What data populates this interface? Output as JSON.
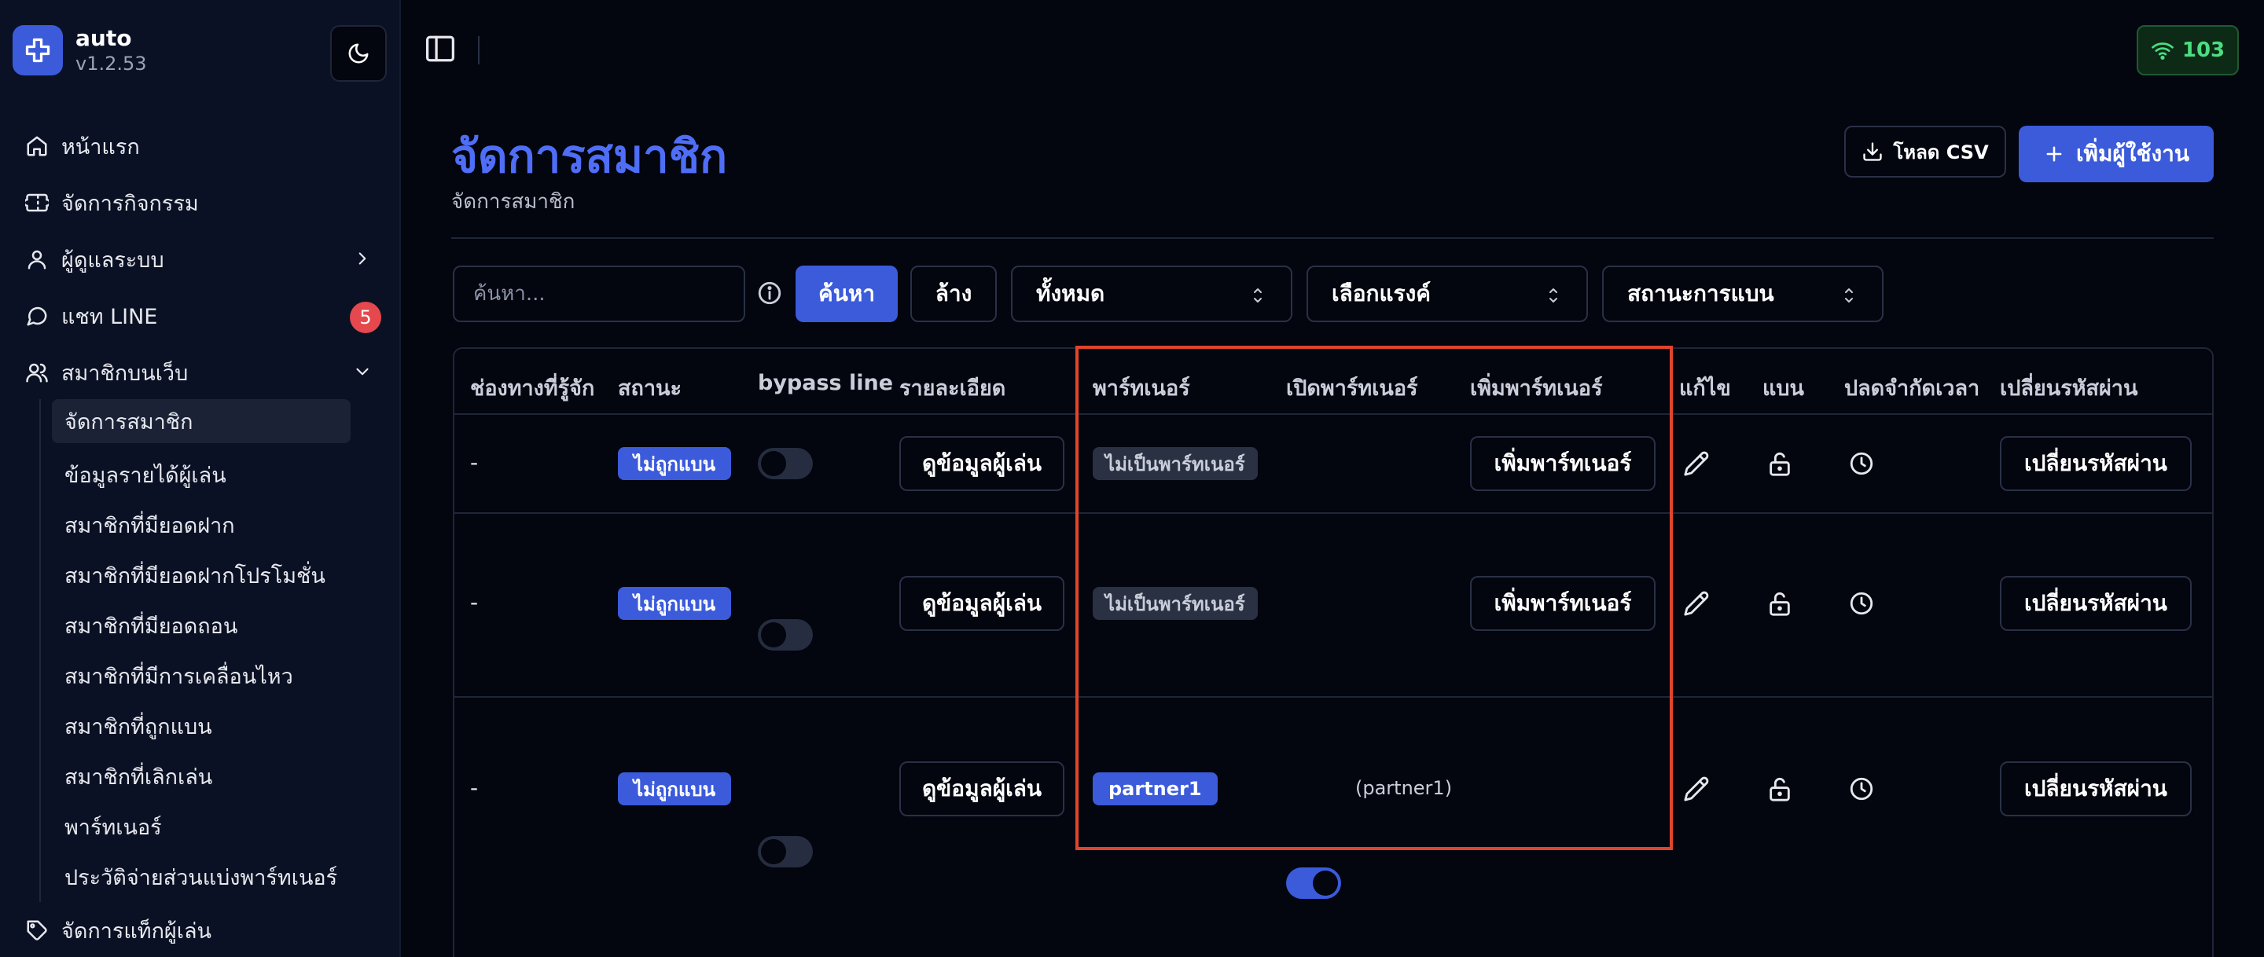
{
  "brand": {
    "name": "auto",
    "version": "v1.2.53"
  },
  "sidebar": {
    "items": [
      {
        "label": "หน้าแรก"
      },
      {
        "label": "จัดการกิจกรรม"
      },
      {
        "label": "ผู้ดูแลระบบ"
      },
      {
        "label": "แชท LINE",
        "badge": "5"
      },
      {
        "label": "สมาชิกบนเว็บ"
      }
    ],
    "sub_items": [
      {
        "label": "จัดการสมาชิก",
        "active": true
      },
      {
        "label": "ข้อมูลรายได้ผู้เล่น"
      },
      {
        "label": "สมาชิกที่มียอดฝาก"
      },
      {
        "label": "สมาชิกที่มียอดฝากโปรโมชั่น"
      },
      {
        "label": "สมาชิกที่มียอดถอน"
      },
      {
        "label": "สมาชิกที่มีการเคลื่อนไหว"
      },
      {
        "label": "สมาชิกที่ถูกแบน"
      },
      {
        "label": "สมาชิกที่เลิกเล่น"
      },
      {
        "label": "พาร์ทเนอร์"
      },
      {
        "label": "ประวัติจ่ายส่วนแบ่งพาร์ทเนอร์"
      }
    ],
    "bottom_item": {
      "label": "จัดการแท็กผู้เล่น"
    }
  },
  "topbar": {
    "signal_count": "103"
  },
  "header": {
    "title": "จัดการสมาชิก",
    "subtitle": "จัดการสมาชิก",
    "csv_label": "โหลด CSV",
    "add_label": "เพิ่มผู้ใช้งาน"
  },
  "filters": {
    "search_placeholder": "ค้นหา...",
    "search_label": "ค้นหา",
    "clear_label": "ล้าง",
    "status_select": "ทั้งหมด",
    "rank_select": "เลือกแรงค์",
    "ban_select": "สถานะการแบน"
  },
  "table": {
    "columns": [
      "ช่องทางที่รู้จัก",
      "สถานะ",
      "bypass line",
      "รายละเอียด",
      "พาร์ทเนอร์",
      "เปิดพาร์ทเนอร์",
      "เพิ่มพาร์ทเนอร์",
      "แก้ไข",
      "แบน",
      "ปลดจำกัดเวลา",
      "เปลี่ยนรหัสผ่าน"
    ],
    "rows": [
      {
        "channel": "-",
        "status": "ไม่ถูกแบน",
        "bypass": false,
        "detail_btn": "ดูข้อมูลผู้เล่น",
        "partner": "ไม่เป็นพาร์ทเนอร์",
        "partner_is_member": false,
        "open_partner": null,
        "open_partner_label": "",
        "add_partner_btn": "เพิ่มพาร์ทเนอร์",
        "password_btn": "เปลี่ยนรหัสผ่าน"
      },
      {
        "channel": "-",
        "status": "ไม่ถูกแบน",
        "bypass": false,
        "detail_btn": "ดูข้อมูลผู้เล่น",
        "partner": "ไม่เป็นพาร์ทเนอร์",
        "partner_is_member": false,
        "open_partner": null,
        "open_partner_label": "",
        "add_partner_btn": "เพิ่มพาร์ทเนอร์",
        "password_btn": "เปลี่ยนรหัสผ่าน"
      },
      {
        "channel": "-",
        "status": "ไม่ถูกแบน",
        "bypass": false,
        "detail_btn": "ดูข้อมูลผู้เล่น",
        "partner": "partner1",
        "partner_is_member": true,
        "open_partner": true,
        "open_partner_label": "(partner1)",
        "add_partner_btn": "",
        "password_btn": "เปลี่ยนรหัสผ่าน"
      }
    ]
  },
  "colors": {
    "accent": "#3b5bdb",
    "title": "#4f6ef7",
    "highlight": "#e0452c",
    "signal": "#4ade80"
  }
}
